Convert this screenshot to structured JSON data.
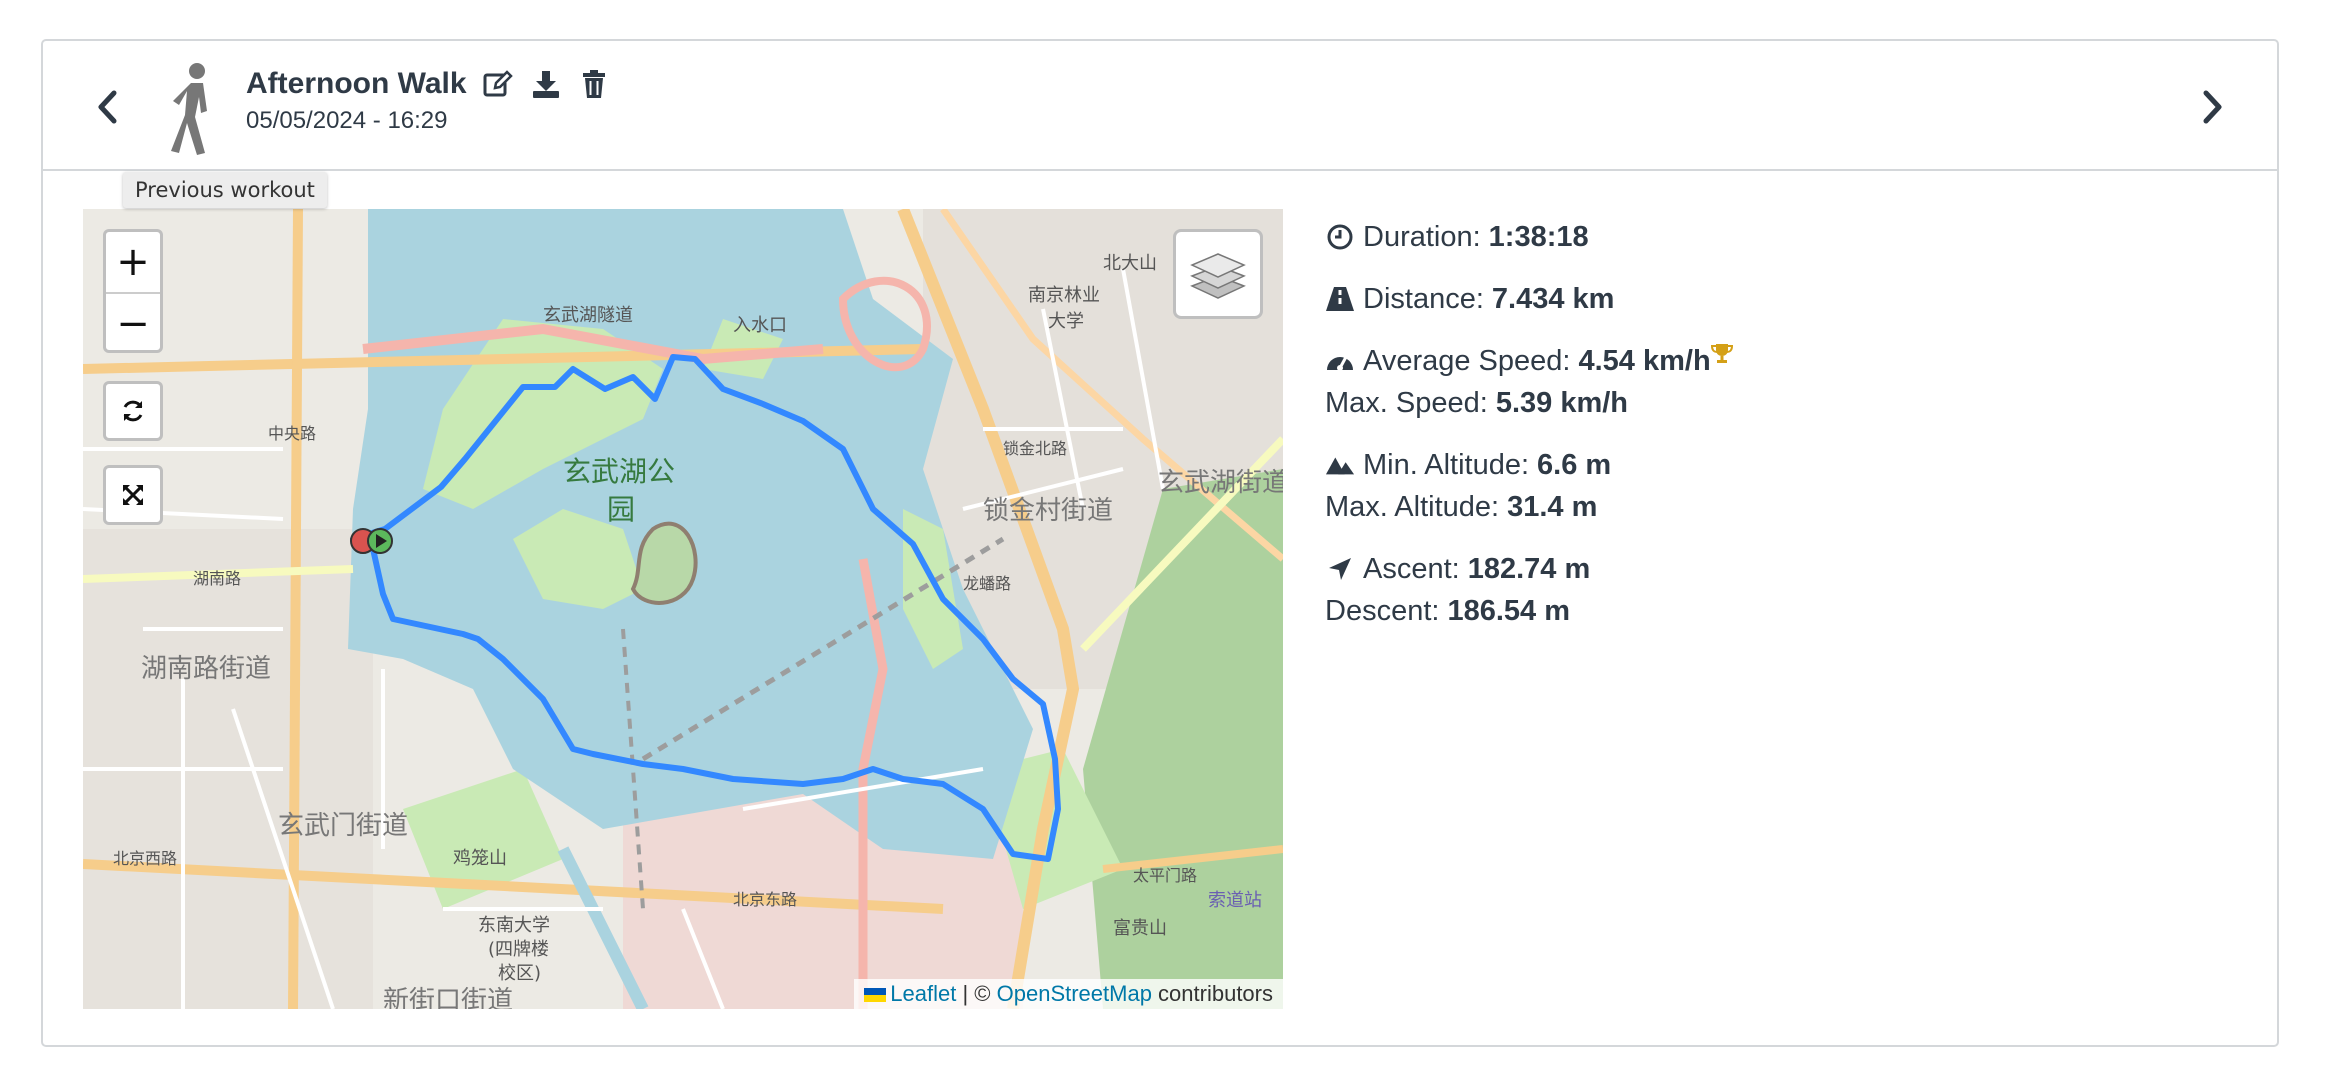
{
  "workout": {
    "title": "Afternoon Walk",
    "date": "05/05/2024 - 16:29",
    "sport_icon": "walking-person-icon"
  },
  "header": {
    "prev_icon": "chevron-left-icon",
    "next_icon": "chevron-right-icon",
    "actions": [
      "edit-icon",
      "download-icon",
      "trash-icon"
    ]
  },
  "tooltip": {
    "text": "Previous workout"
  },
  "map": {
    "zoom_in": "+",
    "zoom_out": "−",
    "attribution": {
      "leaflet": "Leaflet",
      "separator": " | © ",
      "osm": "OpenStreetMap",
      "suffix": " contributors"
    },
    "labels": {
      "park_line1": "玄武湖公",
      "park_line2": "园",
      "district1": "锁金村街道",
      "district2": "湖南路街道",
      "district3": "玄武门街道",
      "district4": "玄武湖街道",
      "road1": "玄武湖隧道",
      "road2": "入水口",
      "road3": "南京林业",
      "road4": "大学",
      "road5": "北京东路",
      "road6": "北京西路",
      "road7": "湖南路",
      "road8": "北大山",
      "road9": "鸡笼山",
      "road10": "东南大学",
      "road11": "(四牌楼",
      "road12": "校区)",
      "road13": "锁金北路",
      "road14": "中央路",
      "road15": "龙蟠路",
      "road16": "太平门路",
      "road17": "富贵山",
      "road18": "索道站",
      "road19": "新街口街道"
    },
    "colors": {
      "water": "#a9d2e0",
      "route": "#3388ff",
      "park": "#c9eab5",
      "road_major": "#f6cd8b"
    }
  },
  "stats": {
    "duration": {
      "label": "Duration:",
      "value": "1:38:18",
      "icon": "clock-icon"
    },
    "distance": {
      "label": "Distance:",
      "value": "7.434 km",
      "icon": "road-icon"
    },
    "avg_speed": {
      "label": "Average Speed:",
      "value": "4.54 km/h",
      "icon": "speedometer-icon",
      "badge": "trophy-icon"
    },
    "max_speed": {
      "label": "Max. Speed:",
      "value": "5.39 km/h"
    },
    "min_alt": {
      "label": "Min. Altitude:",
      "value": "6.6 m",
      "icon": "mountains-icon"
    },
    "max_alt": {
      "label": "Max. Altitude:",
      "value": "31.4 m"
    },
    "ascent": {
      "label": "Ascent:",
      "value": "182.74 m",
      "icon": "location-arrow-icon"
    },
    "descent": {
      "label": "Descent:",
      "value": "186.54 m"
    }
  }
}
